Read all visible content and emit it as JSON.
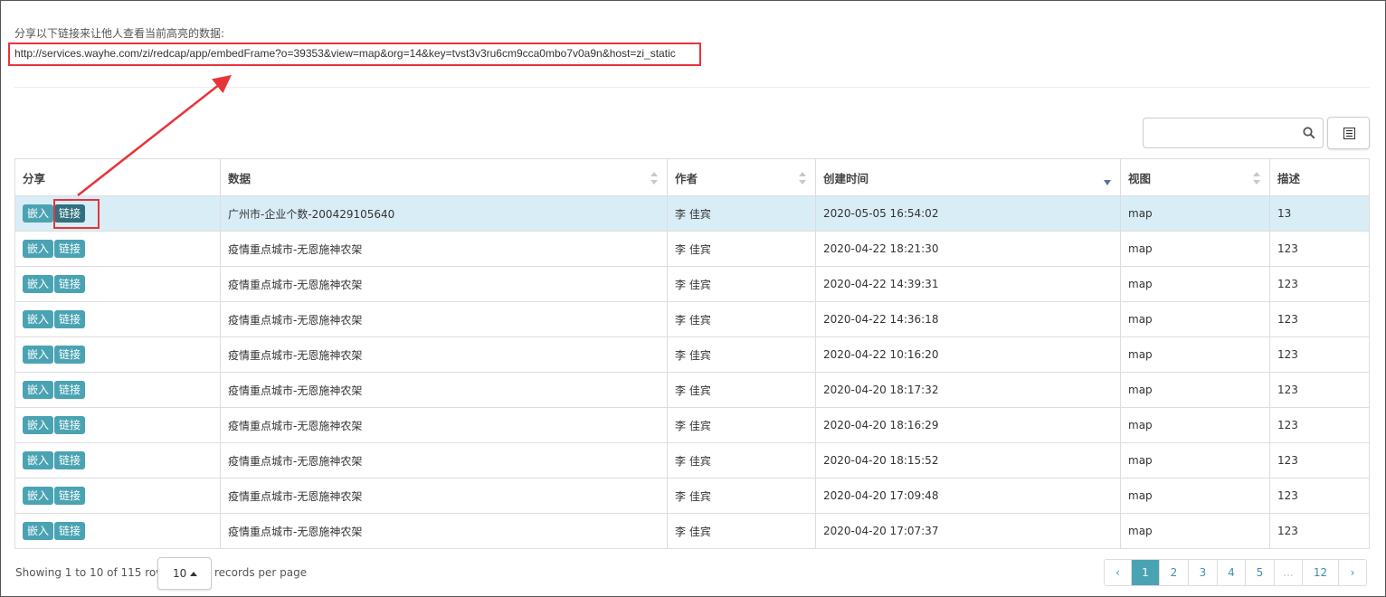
{
  "share": {
    "hint": "分享以下链接来让他人查看当前高亮的数据:",
    "url": "http://services.wayhe.com/zi/redcap/app/embedFrame?o=39353&view=map&org=14&key=tvst3v3ru6cm9cca0mbo7v0a9n&host=zi_static"
  },
  "toolbar": {
    "search_placeholder": "",
    "search_icon": "search-icon",
    "columns_icon": "list-icon"
  },
  "table": {
    "headers": [
      "分享",
      "数据",
      "作者",
      "创建时间",
      "视图",
      "描述"
    ],
    "embed_label": "嵌入",
    "link_label": "链接",
    "rows": [
      {
        "data": "广州市-企业个数-200429105640",
        "author": "李 佳宾",
        "created": "2020-05-05 16:54:02",
        "view": "map",
        "desc": "13"
      },
      {
        "data": "疫情重点城市-无恩施神农架",
        "author": "李 佳宾",
        "created": "2020-04-22 18:21:30",
        "view": "map",
        "desc": "123"
      },
      {
        "data": "疫情重点城市-无恩施神农架",
        "author": "李 佳宾",
        "created": "2020-04-22 14:39:31",
        "view": "map",
        "desc": "123"
      },
      {
        "data": "疫情重点城市-无恩施神农架",
        "author": "李 佳宾",
        "created": "2020-04-22 14:36:18",
        "view": "map",
        "desc": "123"
      },
      {
        "data": "疫情重点城市-无恩施神农架",
        "author": "李 佳宾",
        "created": "2020-04-22 10:16:20",
        "view": "map",
        "desc": "123"
      },
      {
        "data": "疫情重点城市-无恩施神农架",
        "author": "李 佳宾",
        "created": "2020-04-20 18:17:32",
        "view": "map",
        "desc": "123"
      },
      {
        "data": "疫情重点城市-无恩施神农架",
        "author": "李 佳宾",
        "created": "2020-04-20 18:16:29",
        "view": "map",
        "desc": "123"
      },
      {
        "data": "疫情重点城市-无恩施神农架",
        "author": "李 佳宾",
        "created": "2020-04-20 18:15:52",
        "view": "map",
        "desc": "123"
      },
      {
        "data": "疫情重点城市-无恩施神农架",
        "author": "李 佳宾",
        "created": "2020-04-20 17:09:48",
        "view": "map",
        "desc": "123"
      },
      {
        "data": "疫情重点城市-无恩施神农架",
        "author": "李 佳宾",
        "created": "2020-04-20 17:07:37",
        "view": "map",
        "desc": "123"
      }
    ]
  },
  "footer": {
    "showing": "Showing 1 to 10 of 115 rows",
    "page_size": "10",
    "records_per_page": "records per page",
    "pages": [
      "‹",
      "1",
      "2",
      "3",
      "4",
      "5",
      "...",
      "12",
      "›"
    ],
    "active_page": "1"
  },
  "colors": {
    "annotation_red": "#e8333a",
    "highlight_row": "#d9edf7",
    "button_teal": "#4aa3b3"
  }
}
